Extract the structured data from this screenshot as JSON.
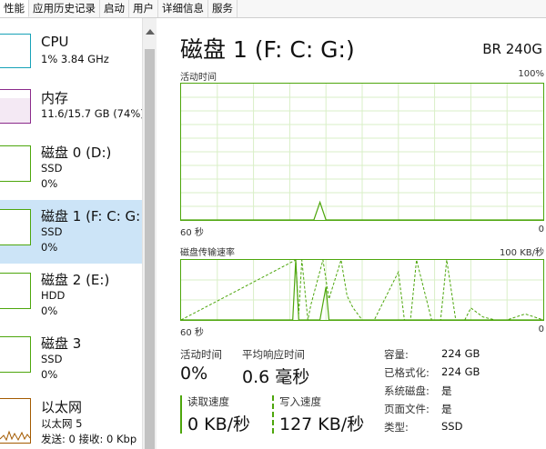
{
  "tabs": [
    "性能",
    "应用历史记录",
    "启动",
    "用户",
    "详细信息",
    "服务"
  ],
  "sidebar": {
    "items": [
      {
        "name": "CPU",
        "line1": "1% 3.84 GHz",
        "line2": ""
      },
      {
        "name": "内存",
        "line1": "11.6/15.7 GB (74%)",
        "line2": ""
      },
      {
        "name": "磁盘 0 (D:)",
        "line1": "SSD",
        "line2": "0%"
      },
      {
        "name": "磁盘 1 (F: C: G:",
        "line1": "SSD",
        "line2": "0%"
      },
      {
        "name": "磁盘 2 (E:)",
        "line1": "HDD",
        "line2": "0%"
      },
      {
        "name": "磁盘 3",
        "line1": "SSD",
        "line2": "0%"
      },
      {
        "name": "以太网",
        "line1": "以太网 5",
        "line2": "发送: 0 接收: 0 Kbp"
      }
    ]
  },
  "main": {
    "title": "磁盘 1 (F: C: G:)",
    "model": "BR 240G",
    "activity_graph": {
      "label": "活动时间",
      "max_label": "100%",
      "time_label": "60 秒",
      "min_label": "0"
    },
    "transfer_graph": {
      "label": "磁盘传输速率",
      "max_label": "100 KB/秒",
      "time_label": "60 秒",
      "min_label": "0"
    },
    "stats": {
      "active_time_label": "活动时间",
      "active_time_value": "0%",
      "avg_response_label": "平均响应时间",
      "avg_response_value": "0.6 毫秒",
      "read_speed_label": "读取速度",
      "read_speed_value": "0 KB/秒",
      "write_speed_label": "写入速度",
      "write_speed_value": "127 KB/秒"
    },
    "props": [
      {
        "label": "容量:",
        "value": "224 GB"
      },
      {
        "label": "已格式化:",
        "value": "224 GB"
      },
      {
        "label": "系统磁盘:",
        "value": "是"
      },
      {
        "label": "页面文件:",
        "value": "是"
      },
      {
        "label": "类型:",
        "value": "SSD"
      }
    ]
  },
  "colors": {
    "accent_green": "#4da60c",
    "grid": "#d9efc7",
    "selected": "#cce4f7",
    "disk_border": "#4da60c",
    "cpu_border": "#17a2b8",
    "mem_border": "#8b2a8b",
    "net_border": "#a35a00"
  },
  "chart_data": [
    {
      "type": "line",
      "title": "活动时间",
      "ylabel": "",
      "ylim": [
        0,
        100
      ],
      "xlim": [
        60,
        0
      ],
      "series": [
        {
          "name": "",
          "x": [
            60,
            38,
            37,
            36,
            0
          ],
          "y": [
            0,
            0,
            13,
            0,
            0
          ]
        }
      ]
    },
    {
      "type": "line",
      "title": "磁盘传输速率",
      "ylim": [
        0,
        100
      ],
      "xlim": [
        60,
        0
      ],
      "series": [
        {
          "name": "",
          "style": "solid",
          "x": [
            60,
            41.5,
            41,
            40.5,
            37,
            36,
            35.5,
            0
          ],
          "y": [
            0,
            0,
            100,
            0,
            0,
            55,
            0,
            0
          ]
        },
        {
          "name": "",
          "style": "dashed",
          "x": [
            60,
            41,
            40.5,
            40,
            39,
            38.5,
            36.5,
            35.5,
            33.5,
            32.5,
            31.5,
            30,
            28,
            24,
            23,
            22,
            21,
            18.5,
            17,
            16,
            14.5,
            13,
            12,
            10,
            8,
            6,
            3,
            0
          ],
          "y": [
            0,
            100,
            10,
            100,
            0,
            25,
            100,
            35,
            100,
            40,
            20,
            0,
            0,
            80,
            0,
            0,
            100,
            0,
            0,
            100,
            0,
            0,
            20,
            5,
            0,
            0,
            10,
            0
          ]
        }
      ]
    }
  ]
}
